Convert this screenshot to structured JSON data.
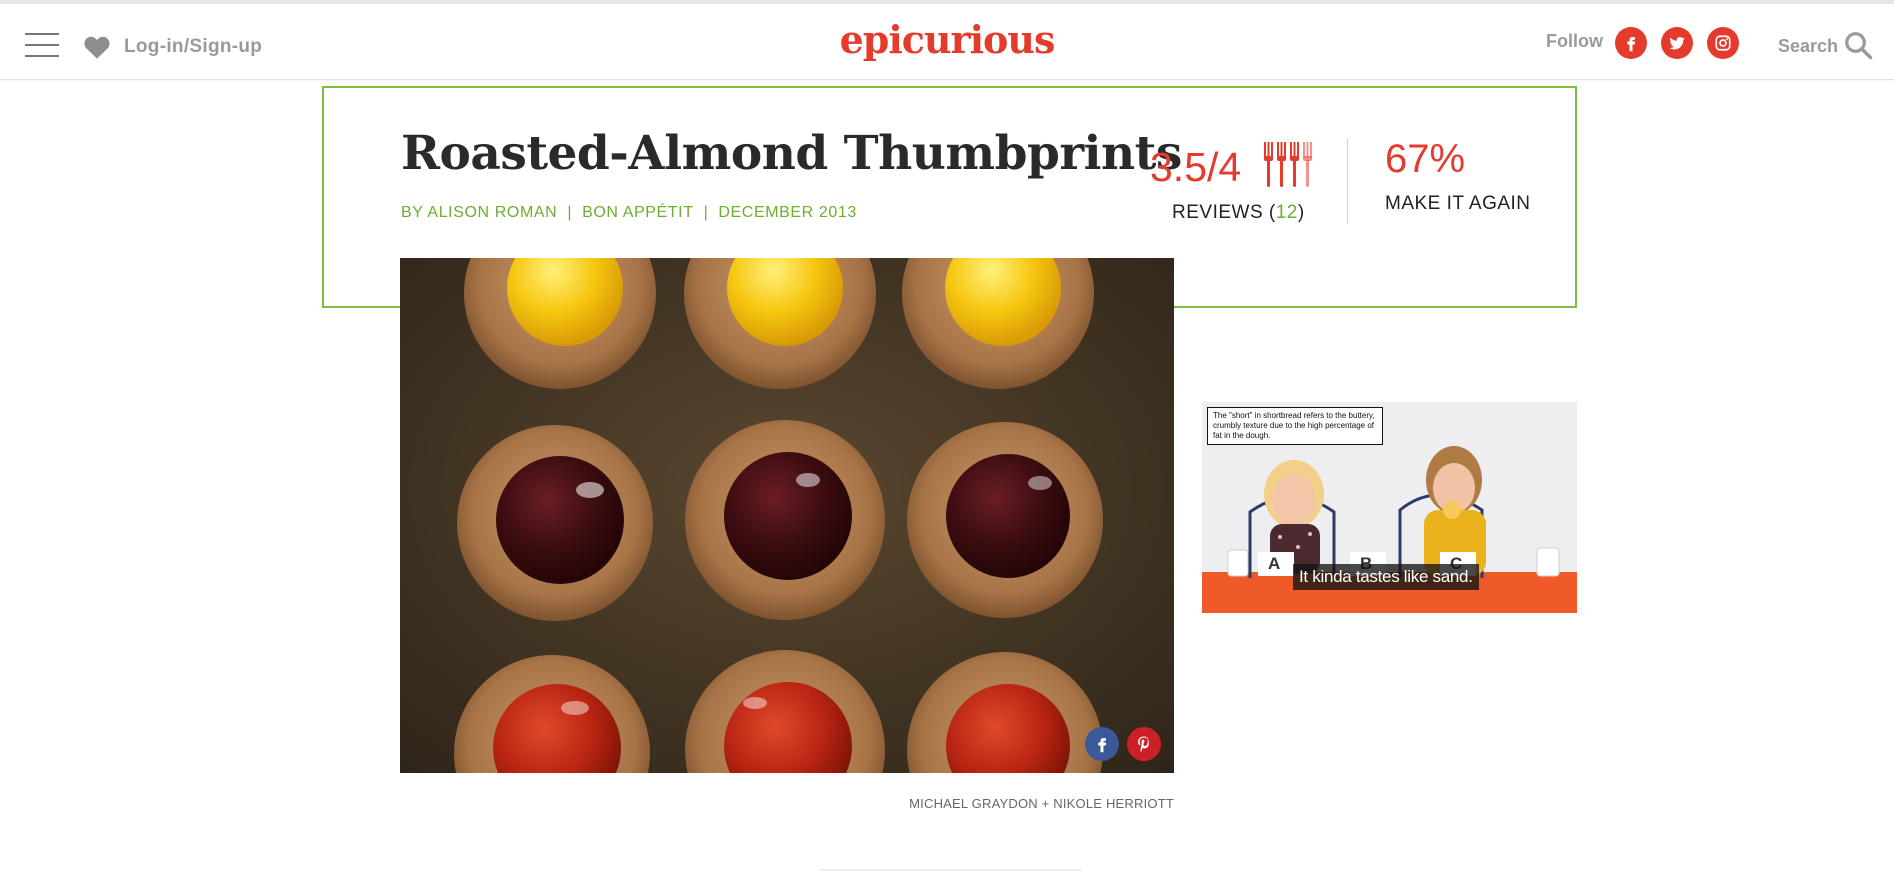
{
  "header": {
    "menu_icon": "hamburger-icon",
    "heart_icon": "heart-icon",
    "login_label": "Log-in/Sign-up",
    "logo_text": "epicurious",
    "follow_label": "Follow",
    "social_icons": [
      "facebook-icon",
      "twitter-icon",
      "instagram-icon"
    ],
    "search_label": "Search",
    "search_icon": "search-icon"
  },
  "recipe": {
    "title": "Roasted-Almond Thumbprints",
    "byline": {
      "author": "BY ALISON ROMAN",
      "source": "BON APPÉTIT",
      "date": "DECEMBER 2013",
      "separator": "|"
    },
    "rating_text": "3.5/4",
    "rating_value": 3.5,
    "rating_max": 4,
    "rating_icon": "fork-icon",
    "reviews_label": "REVIEWS",
    "reviews_count": "12",
    "make_again_pct": "67%",
    "make_again_label": "MAKE IT AGAIN"
  },
  "photo": {
    "share_icons": [
      "facebook-icon",
      "pinterest-icon"
    ],
    "credit": "MICHAEL GRAYDON + NIKOLE HERRIOTT"
  },
  "video": {
    "note": "The \"short\" in shortbread refers to the buttery, crumbly texture due to the high percentage of fat in the dough.",
    "caption": "It kinda tastes like sand.",
    "labels": [
      "A",
      "B",
      "C"
    ]
  },
  "colors": {
    "brand_red": "#e53b2c",
    "accent_green": "#7bbf3c",
    "byline_green": "#6cae2e",
    "facebook_blue": "#3b5998",
    "pinterest_red": "#cb2027"
  }
}
